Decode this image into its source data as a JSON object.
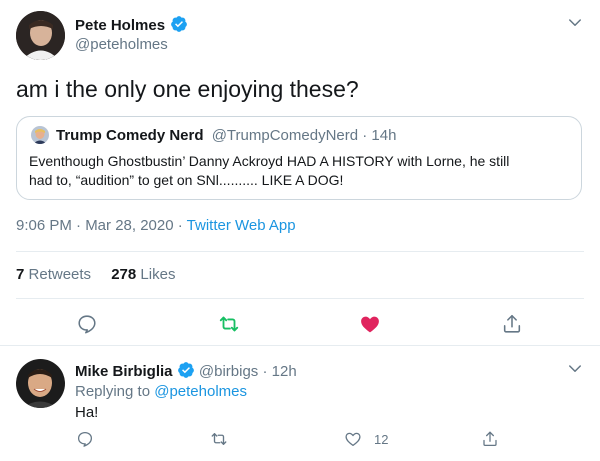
{
  "main_tweet": {
    "author_name": "Pete Holmes",
    "author_handle": "@peteholmes",
    "text": "am i the only one enjoying these?",
    "quoted": {
      "author_name": "Trump Comedy Nerd",
      "author_handle": "@TrumpComedyNerd",
      "time": "14h",
      "text_line1": "Eventhough Ghostbustin’ Danny Ackroyd HAD A HISTORY  with Lorne, he still",
      "text_line2": "had to,  “audition” to get on SNl.......... LIKE A DOG!"
    },
    "timestamp": "9:06 PM · Mar 28, 2020",
    "source": "Twitter Web App",
    "retweets_count": "7",
    "retweets_label": "Retweets",
    "likes_count": "278",
    "likes_label": "Likes",
    "liked": true,
    "retweeted": true
  },
  "reply": {
    "author_name": "Mike Birbiglia",
    "author_handle": "@birbigs",
    "time": "12h",
    "replying_to_prefix": "Replying to",
    "replying_to_handle": "@peteholmes",
    "text": "Ha!",
    "like_count": "12"
  },
  "colors": {
    "accent": "#1b95e0",
    "retweet_green": "#17bf63",
    "like_red": "#e0245e",
    "muted": "#657786",
    "border": "#e6ecf0"
  }
}
